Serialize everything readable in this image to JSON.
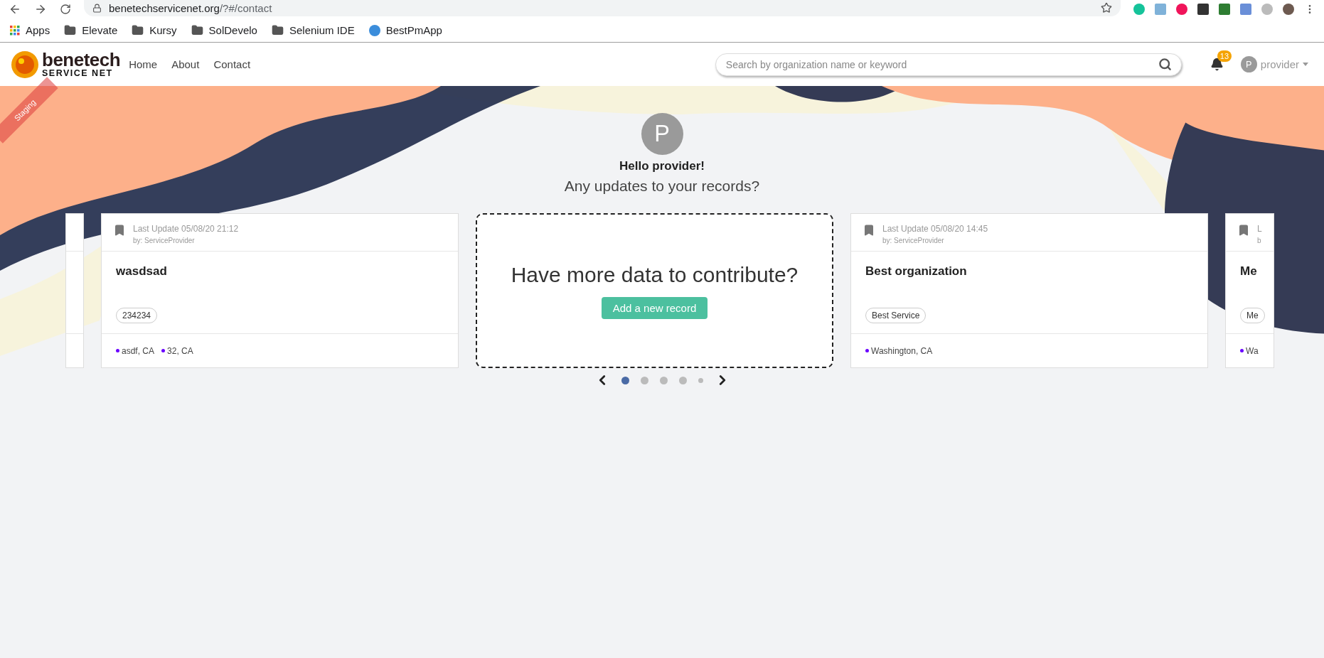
{
  "browser": {
    "url_host": "benetechservicenet.org",
    "url_path": "/?#/contact",
    "bookmarks": [
      {
        "label": "Apps",
        "kind": "apps"
      },
      {
        "label": "Elevate",
        "kind": "folder"
      },
      {
        "label": "Kursy",
        "kind": "folder"
      },
      {
        "label": "SolDevelo",
        "kind": "folder"
      },
      {
        "label": "Selenium IDE",
        "kind": "folder"
      },
      {
        "label": "BestPmApp",
        "kind": "site"
      }
    ]
  },
  "header": {
    "logo": {
      "line1": "benetech",
      "line2": "SERVICE NET",
      "ribbon": "Staging"
    },
    "nav": [
      {
        "label": "Home"
      },
      {
        "label": "About"
      },
      {
        "label": "Contact"
      }
    ],
    "search": {
      "placeholder": "Search by organization name or keyword"
    },
    "notifications": {
      "count": "13"
    },
    "user": {
      "initial": "P",
      "name": "provider"
    }
  },
  "greeting": {
    "initial": "P",
    "title": "Hello provider!",
    "subtitle": "Any updates to your records?"
  },
  "cards": [
    {
      "kind": "stub"
    },
    {
      "kind": "record",
      "updated": "Last Update 05/08/20 21:12",
      "by": "by: ServiceProvider",
      "name": "wasdsad",
      "tags": [
        "234234"
      ],
      "locations": [
        {
          "label": "asdf, CA",
          "color": "#6a00ff"
        },
        {
          "label": "32, CA",
          "color": "#6a00ff"
        }
      ]
    },
    {
      "kind": "add",
      "title": "Have more data to contribute?",
      "button": "Add a new record"
    },
    {
      "kind": "record",
      "updated": "Last Update 05/08/20 14:45",
      "by": "by: ServiceProvider",
      "name": "Best organization",
      "tags": [
        "Best Service"
      ],
      "locations": [
        {
          "label": "Washington, CA",
          "color": "#6a00ff"
        }
      ]
    },
    {
      "kind": "peek",
      "updated": "L",
      "by": "b",
      "name": "Me",
      "tags": [
        "Me"
      ],
      "locations": [
        {
          "label": "Wa",
          "color": "#6a00ff"
        }
      ]
    }
  ],
  "pager": {
    "dots": [
      {
        "selected": true,
        "small": false
      },
      {
        "selected": false,
        "small": false
      },
      {
        "selected": false,
        "small": false
      },
      {
        "selected": false,
        "small": false
      },
      {
        "selected": false,
        "small": true
      }
    ]
  }
}
